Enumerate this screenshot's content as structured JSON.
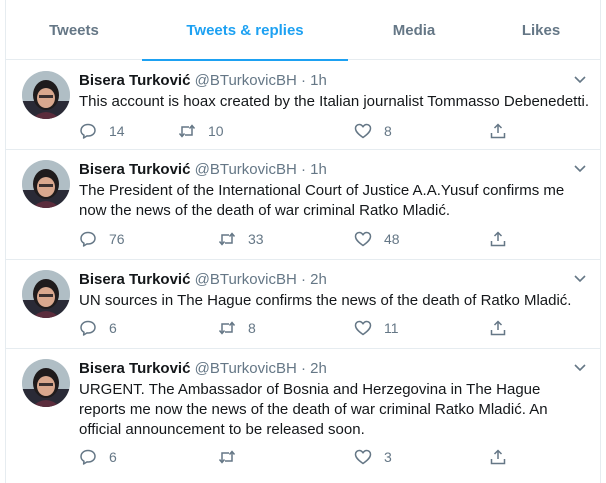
{
  "tabs": [
    {
      "label": "Tweets",
      "active": false
    },
    {
      "label": "Tweets & replies",
      "active": true
    },
    {
      "label": "Media",
      "active": false
    },
    {
      "label": "Likes",
      "active": false
    }
  ],
  "accent_color": "#1da1f2",
  "tweets": [
    {
      "name": "Bisera Turković",
      "handle": "@BTurkovicBH",
      "separator": "·",
      "time": "1h",
      "text": "This account is hoax created by the Italian journalist Tommasso Debenedetti.",
      "replies": "14",
      "retweets": "10",
      "likes": "8"
    },
    {
      "name": "Bisera Turković",
      "handle": "@BTurkovicBH",
      "separator": "·",
      "time": "1h",
      "text": "The President of the International Court of Justice A.A.Yusuf confirms me now the news of the death of war criminal Ratko Mladić.",
      "replies": "76",
      "retweets": "33",
      "likes": "48"
    },
    {
      "name": "Bisera Turković",
      "handle": "@BTurkovicBH",
      "separator": "·",
      "time": "2h",
      "text": "UN sources in The Hague confirms the news of the death of Ratko Mladić.",
      "replies": "6",
      "retweets": "8",
      "likes": "11"
    },
    {
      "name": "Bisera Turković",
      "handle": "@BTurkovicBH",
      "separator": "·",
      "time": "2h",
      "text": "URGENT. The Ambassador of Bosnia and Herzegovina in The Hague reports me now the news of the death of war criminal Ratko Mladić. An official announcement to be released soon.",
      "replies": "6",
      "retweets": "",
      "likes": "3"
    }
  ],
  "icons": {
    "reply": "reply-icon",
    "retweet": "retweet-icon",
    "like": "heart-icon",
    "share": "share-icon",
    "more": "chevron-down-icon"
  }
}
